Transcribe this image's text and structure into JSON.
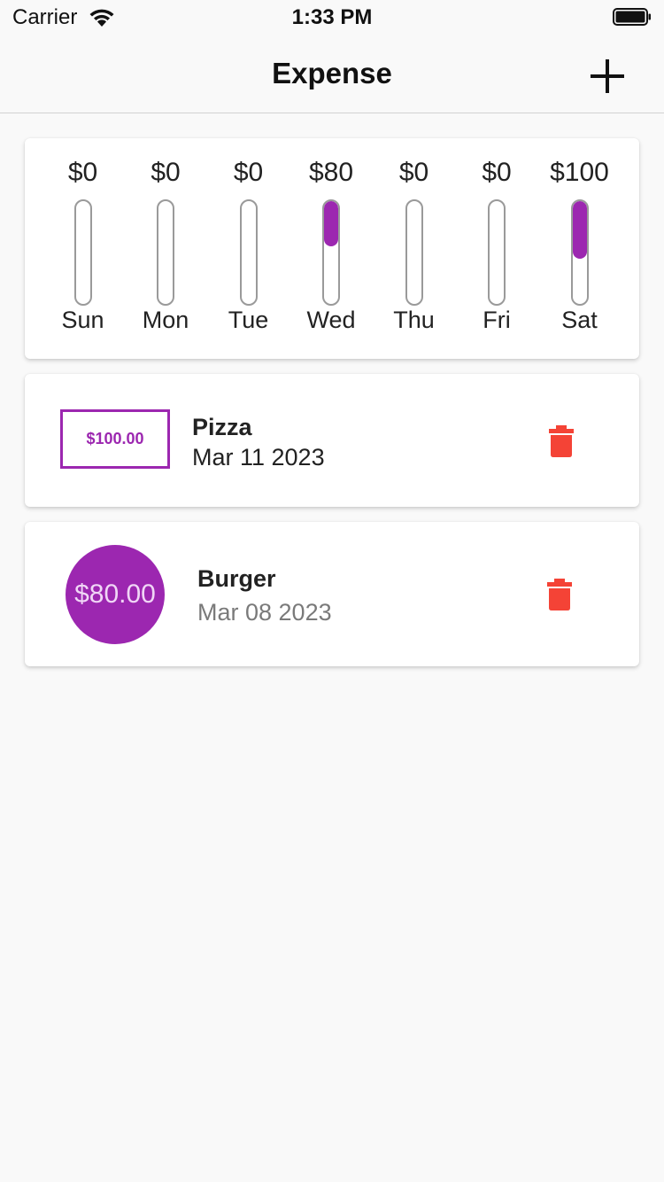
{
  "status_bar": {
    "carrier": "Carrier",
    "time": "1:33 PM"
  },
  "nav": {
    "title": "Expense",
    "add_icon": "plus-icon"
  },
  "chart_data": {
    "type": "bar",
    "categories": [
      "Sun",
      "Mon",
      "Tue",
      "Wed",
      "Thu",
      "Fri",
      "Sat"
    ],
    "value_labels": [
      "$0",
      "$0",
      "$0",
      "$80",
      "$0",
      "$0",
      "$100"
    ],
    "values": [
      0,
      0,
      0,
      80,
      0,
      0,
      100
    ],
    "fill_fraction": [
      0,
      0,
      0,
      0.44,
      0,
      0,
      0.56
    ],
    "colors": {
      "fill": "#9c27b0",
      "track_border": "#9a9a9a"
    }
  },
  "transactions": [
    {
      "amount": "$100.00",
      "title": "Pizza",
      "date": "Mar 11 2023",
      "delete_icon": "trash-icon"
    },
    {
      "amount": "$80.00",
      "title": "Burger",
      "date": "Mar 08 2023",
      "delete_icon": "trash-icon"
    }
  ],
  "colors": {
    "accent": "#9c27b0",
    "delete": "#f44336"
  }
}
